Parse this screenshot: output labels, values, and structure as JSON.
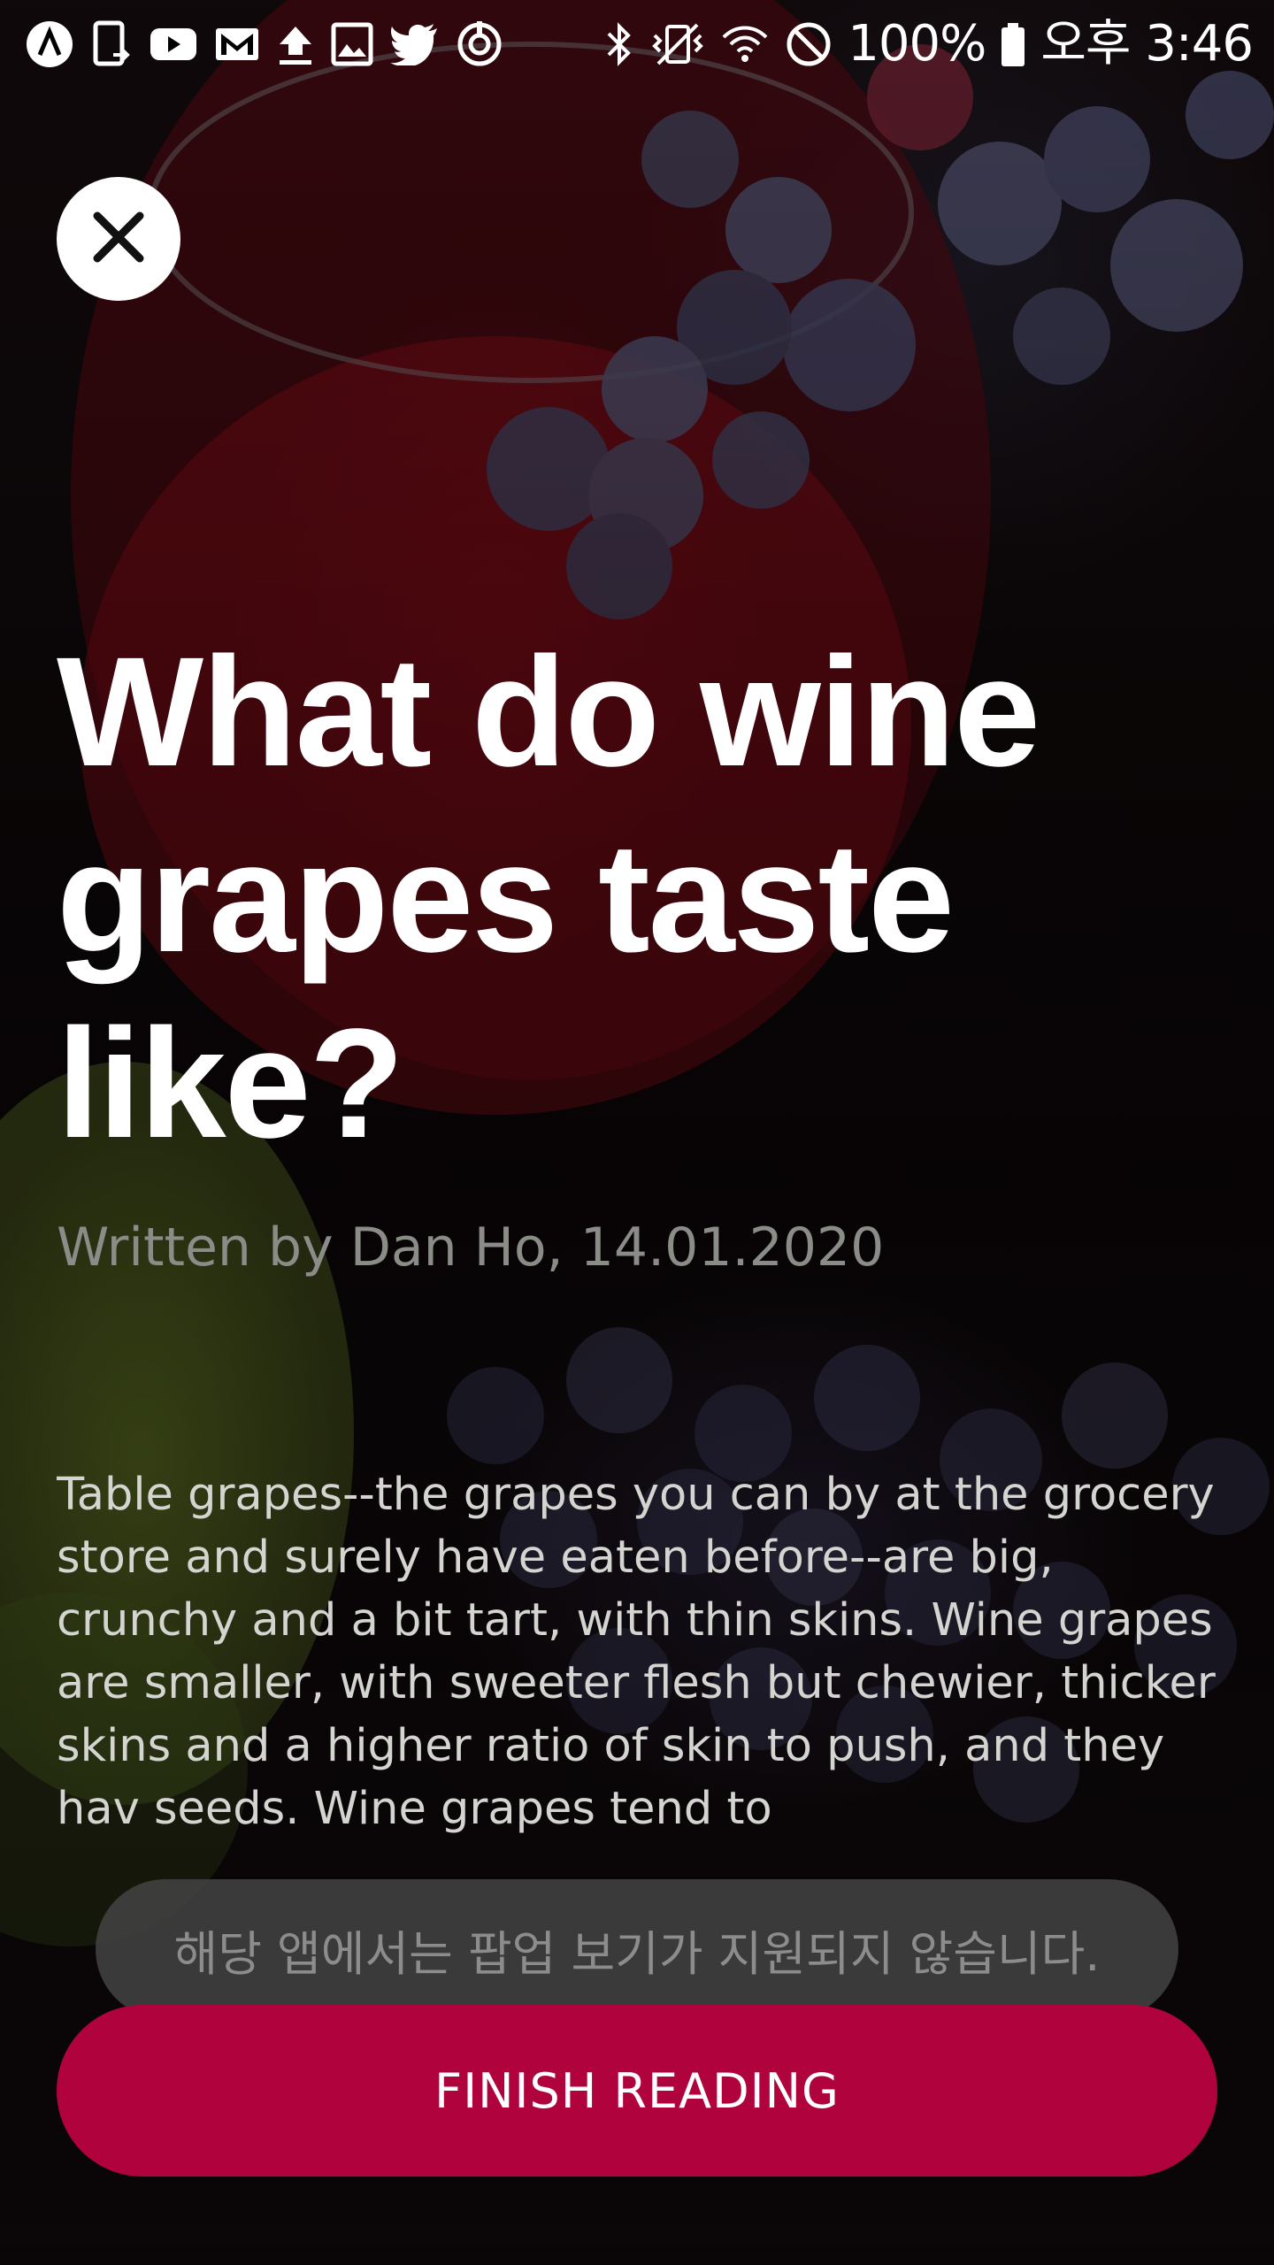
{
  "status_bar": {
    "left_icons": [
      "app-a-icon",
      "phone-transfer-icon",
      "youtube-icon",
      "gmail-icon",
      "upload-icon",
      "gallery-icon",
      "twitter-icon",
      "sync-icon"
    ],
    "right_icons": [
      "bluetooth-icon",
      "vibrate-mute-icon",
      "wifi-icon",
      "blocked-icon",
      "battery-icon"
    ],
    "battery_text": "100%",
    "time_text": "오후 3:46"
  },
  "article": {
    "title": "What do wine grapes taste like?",
    "byline": "Written by Dan Ho, 14.01.2020",
    "body": "Table grapes--the grapes you can by at the grocery store and surely have eaten before--are big, crunchy and a bit tart, with thin skins. Wine grapes are smaller, with sweeter flesh but chewier, thicker skins and a higher ratio of skin to push, and they hav seeds. Wine grapes tend to"
  },
  "toast": {
    "text": "해당 앱에서는 팝업 보기가 지원되지 않습니다."
  },
  "actions": {
    "finish_label": "FINISH READING",
    "close_icon": "close-icon"
  },
  "colors": {
    "accent": "#b0033e",
    "byline": "#8a8c88",
    "body_text": "#d4d4d0"
  }
}
